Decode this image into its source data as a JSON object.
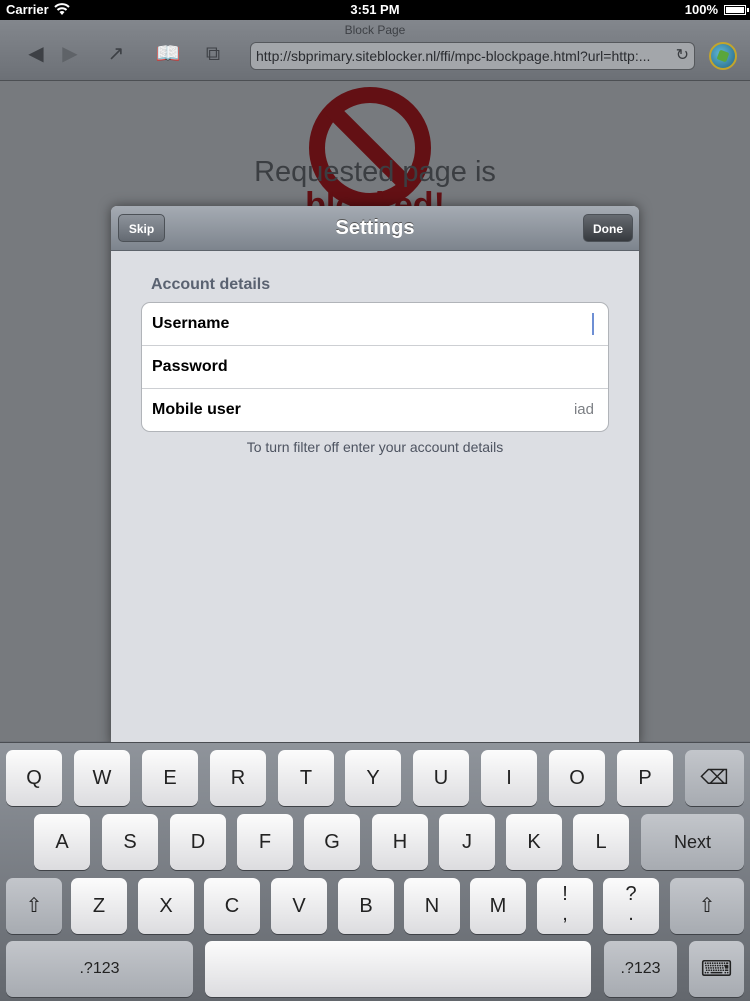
{
  "status_bar": {
    "carrier": "Carrier",
    "time": "3:51 PM",
    "battery": "100%"
  },
  "browser": {
    "page_title": "Block Page",
    "url": "http://sbprimary.siteblocker.nl/ffi/mpc-blockpage.html?url=http:...",
    "buttons": {
      "back": "◀",
      "forward": "▶",
      "share": "↗",
      "bookmarks": "📖",
      "tabs": "⧉",
      "reload": "↻"
    }
  },
  "webpage": {
    "line1": "Requested page is",
    "line2": "blocked!"
  },
  "modal": {
    "title": "Settings",
    "skip_label": "Skip",
    "done_label": "Done",
    "section_title": "Account details",
    "rows": [
      {
        "label": "Username",
        "value": ""
      },
      {
        "label": "Password",
        "value": ""
      },
      {
        "label": "Mobile user",
        "value": "iad"
      }
    ],
    "helper_text": "To turn filter off enter your account details"
  },
  "keyboard": {
    "row1": [
      "Q",
      "W",
      "E",
      "R",
      "T",
      "Y",
      "U",
      "I",
      "O",
      "P"
    ],
    "backspace": "⌫",
    "row2": [
      "A",
      "S",
      "D",
      "F",
      "G",
      "H",
      "J",
      "K",
      "L"
    ],
    "next": "Next",
    "shift": "⇧",
    "row3": [
      "Z",
      "X",
      "C",
      "V",
      "B",
      "N",
      "M"
    ],
    "excl_top": "!",
    "excl_bottom": ",",
    "quest_top": "?",
    "quest_bottom": ".",
    "numbers": ".?123",
    "hide_keyboard": "⌨"
  },
  "colors": {
    "blocked_red": "#631014",
    "nav_bar": "#8f959d",
    "keyboard_bg": "#7a7e84"
  }
}
